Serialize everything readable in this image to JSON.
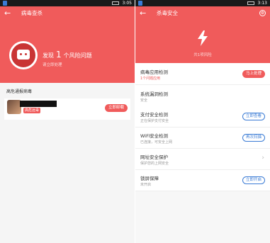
{
  "colors": {
    "accent": "#f05b5b",
    "link_blue": "#3a7bd5"
  },
  "left": {
    "status_time": "3:05",
    "title": "病毒查杀",
    "risk_prefix": "发现",
    "risk_count": "1",
    "risk_suffix": "个风险问题",
    "risk_sub": "请立即处理",
    "section_title": "高危通报病毒",
    "card": {
      "badge": "高危远毒",
      "button": "立即卸载"
    }
  },
  "right": {
    "status_time": "3:13",
    "title": "杀毒安全",
    "header_sub": "共1项风险",
    "rows": [
      {
        "name": "病毒应用检测",
        "desc": "1个问题应用",
        "action": "马上处理"
      },
      {
        "name": "系统漏洞检测",
        "desc": "安全",
        "action": ""
      },
      {
        "name": "支付安全检测",
        "desc": "正在保护支付安全",
        "action": "立即查看"
      },
      {
        "name": "WiFi安全检测",
        "desc": "已连接，可安全上网",
        "action": "再次扫描"
      },
      {
        "name": "网址安全保护",
        "desc": "保护您的上网安全",
        "action": ""
      },
      {
        "name": "锁屏保障",
        "desc": "未开启",
        "action": "立即开启"
      }
    ]
  }
}
